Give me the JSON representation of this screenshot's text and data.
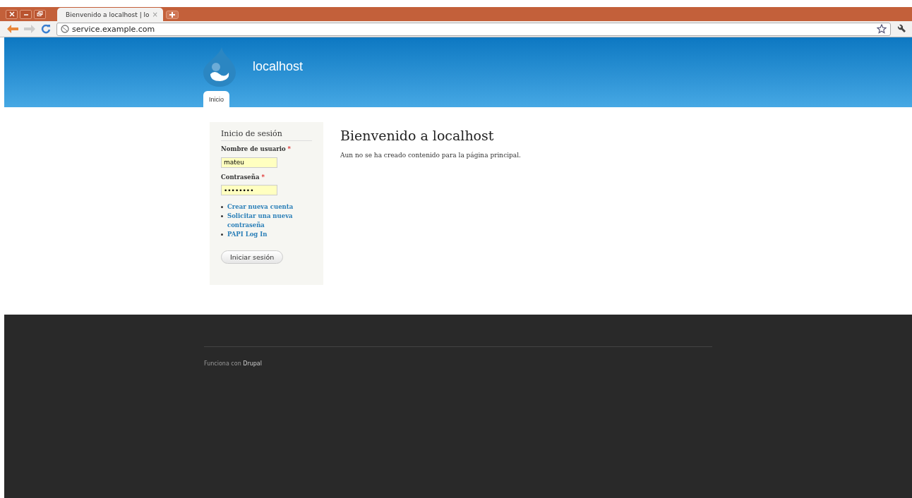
{
  "browser": {
    "tabs": [
      {
        "title": "Bienvenido a localhost | lo",
        "close": "×",
        "selected": true
      }
    ],
    "address": "service.example.com"
  },
  "site": {
    "name": "localhost",
    "nav": [
      {
        "label": "Inicio",
        "selected": true
      }
    ]
  },
  "login": {
    "title": "Inicio de sesión",
    "fields": [
      {
        "label": "Nombre de usuario",
        "required": "*",
        "value": "mateu"
      },
      {
        "label": "Contraseña",
        "required": "*",
        "value": "••••••••"
      }
    ],
    "links": [
      "Crear nueva cuenta",
      "Solicitar una nueva contraseña",
      "PAPI Log In"
    ],
    "button": "Iniciar sesión"
  },
  "main": {
    "title": "Bienvenido a localhost",
    "text": "Aun no se ha creado contenido para la página principal."
  },
  "footer": {
    "text": "Funciona con ",
    "link": "Drupal"
  }
}
